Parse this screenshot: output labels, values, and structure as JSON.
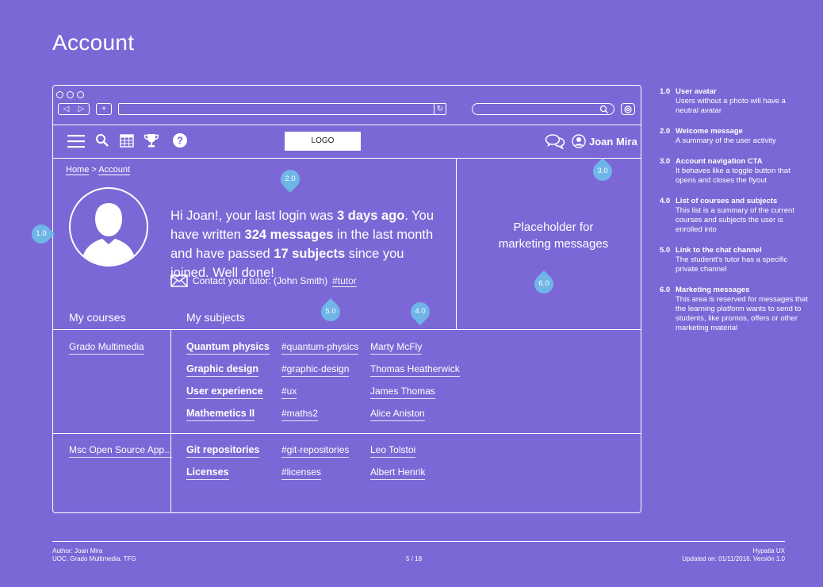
{
  "page_title": "Account",
  "browser": {
    "nav_back": "◁",
    "nav_forward": "▷",
    "new_tab": "+",
    "reload": "↻",
    "search_icon": "magnifier",
    "settings_icon": "gear"
  },
  "toolbar": {
    "logo": "LOGO",
    "user_name": "Joan Mira"
  },
  "breadcrumb": {
    "home": "Home",
    "separator": ">",
    "current": "Account"
  },
  "welcome": {
    "part1": "Hi Joan!, your last login was ",
    "b1": "3 days ago",
    "part2": ".  You have written ",
    "b2": "324 messages",
    "part3": " in the last month and have passed ",
    "b3": "17 subjects",
    "part4": " since you joined. Well done!"
  },
  "contact": {
    "label": "Contact your tutor:  (John Smith)",
    "tag": "#tutor"
  },
  "marketing": {
    "line1": "Placeholder for",
    "line2": "marketing messages"
  },
  "headers": {
    "courses": "My courses",
    "subjects": "My subjects"
  },
  "courses": [
    {
      "name": "Grado Multimedia",
      "subjects": [
        {
          "name": "Quantum physics",
          "tag": "#quantum-physics",
          "tutor": "Marty McFly"
        },
        {
          "name": "Graphic design",
          "tag": "#graphic-design",
          "tutor": "Thomas Heatherwick"
        },
        {
          "name": "User experience",
          "tag": "#ux",
          "tutor": "James Thomas"
        },
        {
          "name": "Mathemetics II",
          "tag": "#maths2",
          "tutor": "Alice Aniston"
        }
      ]
    },
    {
      "name": "Msc Open Source App...",
      "subjects": [
        {
          "name": "Git repositories",
          "tag": "#git-repositories",
          "tutor": "Leo Tolstoi"
        },
        {
          "name": "Licenses",
          "tag": "#licenses",
          "tutor": "Albert Henrik"
        }
      ]
    }
  ],
  "pins": {
    "p1": "1.0",
    "p2": "2.0",
    "p3": "3.0",
    "p4": "4.0",
    "p5": "5.0",
    "p6": "6.0"
  },
  "notes": [
    {
      "num": "1.0",
      "title": "User avatar",
      "text": "Users without a photo will have a neutral avatar"
    },
    {
      "num": "2.0",
      "title": "Welcome message",
      "text": "A summary of the user activity"
    },
    {
      "num": "3.0",
      "title": "Account navigation CTA",
      "text": "It behaves like a toggle button that opens and closes the flyout"
    },
    {
      "num": "4.0",
      "title": "List of courses and subjects",
      "text": "This list is a summary of the current courses and subjects the user is enrolled into"
    },
    {
      "num": "5.0",
      "title": "Link to the chat channel",
      "text": "The studentt's tutor has a specific private channel"
    },
    {
      "num": "6.0",
      "title": "Marketing messages",
      "text": "This area is reserved for messages that the learning platform wants to send to students, like promos, offers or other marketing material"
    }
  ],
  "footer": {
    "author": "Author: Joan Mira",
    "org": "UOC. Grado Multimedia. TFG",
    "page": "5 / 18",
    "product": "Hypatia UX",
    "updated": "Updated on: 01/11/2016. Versión 1.0"
  },
  "colors": {
    "background": "#7b68d6",
    "pin": "#6fb5e8",
    "line": "#ffffff"
  }
}
